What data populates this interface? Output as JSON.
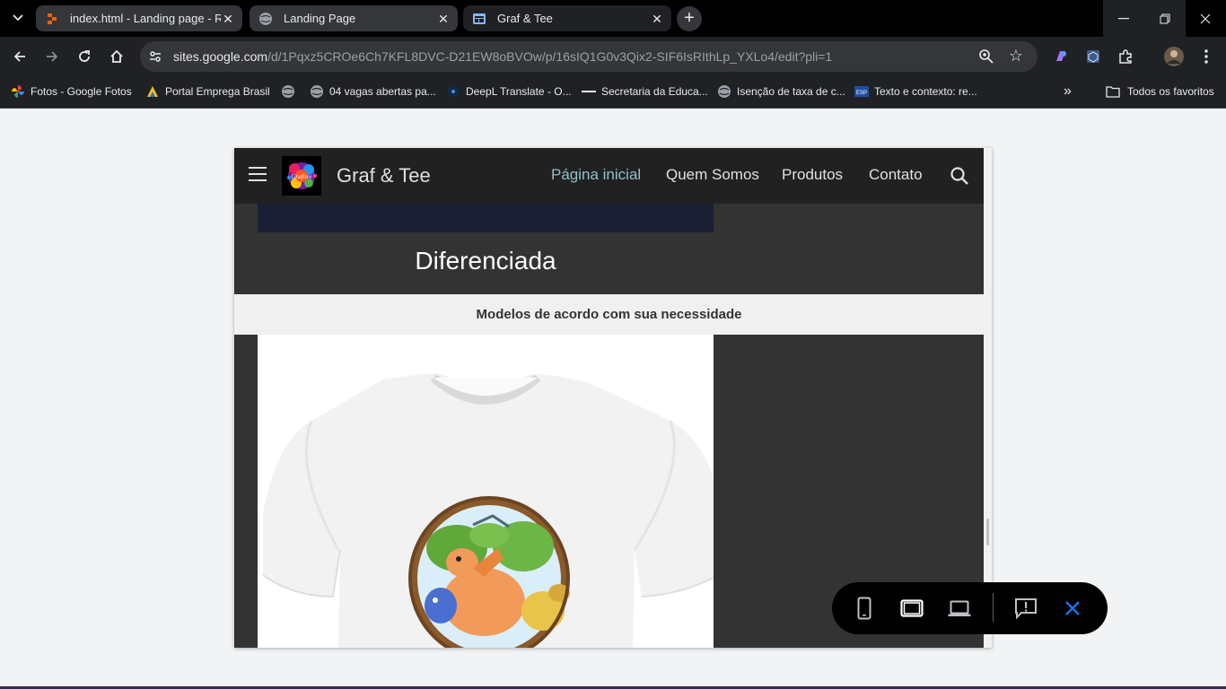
{
  "browser": {
    "tabs": [
      {
        "title": "index.html - Landing page - Replit",
        "icon": "replit-icon",
        "active": false
      },
      {
        "title": "Landing Page",
        "icon": "globe-icon",
        "active": false
      },
      {
        "title": "Graf & Tee",
        "icon": "google-sites-icon",
        "active": true
      }
    ],
    "new_tab": "+",
    "address": {
      "host": "sites.google.com",
      "path": "/d/1Pqxz5CROe6Ch7KFL8DVC-D21EW8oBVOw/p/16sIQ1G0v3Qix2-SIF6IsRIthLp_YXLo4/edit?pli=1"
    },
    "bookmarks": [
      {
        "label": "Fotos - Google Fotos",
        "icon": "google-photos-icon"
      },
      {
        "label": "Portal Emprega Brasil",
        "icon": "emprega-brasil-icon"
      },
      {
        "label": "",
        "icon": "globe-icon"
      },
      {
        "label": "04 vagas abertas pa...",
        "icon": "globe-icon"
      },
      {
        "label": "DeepL Translate - O...",
        "icon": "deepl-icon"
      },
      {
        "label": "Secretaria da Educa...",
        "icon": "dash-icon"
      },
      {
        "label": "Isenção de taxa de c...",
        "icon": "globe-icon"
      },
      {
        "label": "Texto e contexto: re...",
        "icon": "esp-icon"
      }
    ],
    "more_bookmarks": "»",
    "all_bookmarks": "Todos os favoritos"
  },
  "site": {
    "title": "Graf & Tee",
    "logo_text": "Grafitee",
    "nav": [
      "Página inicial",
      "Quem Somos",
      "Produtos",
      "Contato"
    ],
    "active_nav": "Página inicial",
    "heading": "Diferenciada",
    "subheading": "Modelos de acordo com sua necessidade"
  },
  "preview_toolbar": {
    "items": [
      "phone-preview-icon",
      "tablet-preview-icon",
      "laptop-preview-icon",
      "feedback-icon",
      "close-icon"
    ]
  },
  "colors": {
    "nav_active": "#8fc1c9",
    "header_bg": "#212121",
    "section_bg": "#333333",
    "close_accent": "#1a73e8"
  }
}
